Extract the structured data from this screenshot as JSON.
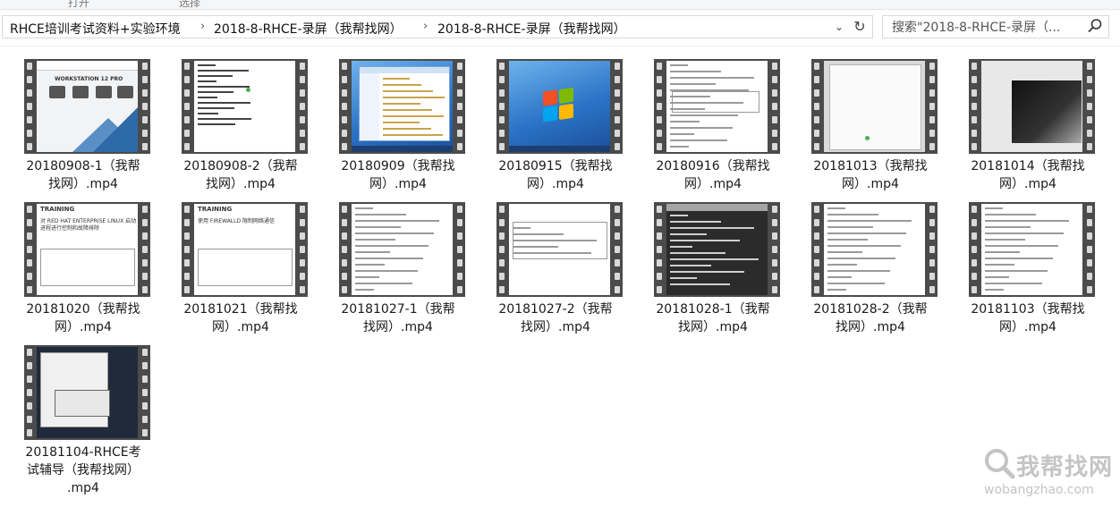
{
  "ribbon": {
    "left_text": "打开",
    "right_text": "选择"
  },
  "breadcrumb": [
    "RHCE培训考试资料+实验环境",
    "2018-8-RHCE-录屏（我帮找网）",
    "2018-8-RHCE-录屏（我帮找网）"
  ],
  "search": {
    "placeholder": "搜索\"2018-8-RHCE-录屏（..."
  },
  "files": [
    {
      "line1": "20180908-1（我帮",
      "line2": "找网）.mp4",
      "line3": "",
      "thumb": "vmware"
    },
    {
      "line1": "20180908-2（我帮",
      "line2": "找网）.mp4",
      "line3": "",
      "thumb": "terminal"
    },
    {
      "line1": "20180909（我帮找",
      "line2": "网）.mp4",
      "line3": "",
      "thumb": "win7-explorer"
    },
    {
      "line1": "20180915（我帮找",
      "line2": "网）.mp4",
      "line3": "",
      "thumb": "win7-desktop"
    },
    {
      "line1": "20180916（我帮找",
      "line2": "网）.mp4",
      "line3": "",
      "thumb": "document"
    },
    {
      "line1": "20181013（我帮找",
      "line2": "网）.mp4",
      "line3": "",
      "thumb": "gray-window"
    },
    {
      "line1": "20181014（我帮找",
      "line2": "网）.mp4",
      "line3": "",
      "thumb": "dark-window"
    },
    {
      "line1": "20181020（我帮找",
      "line2": "网）.mp4",
      "line3": "",
      "thumb": "training-1"
    },
    {
      "line1": "20181021（我帮找",
      "line2": "网）.mp4",
      "line3": "",
      "thumb": "training-2"
    },
    {
      "line1": "20181027-1（我帮",
      "line2": "找网）.mp4",
      "line3": "",
      "thumb": "document-list"
    },
    {
      "line1": "20181027-2（我帮",
      "line2": "找网）.mp4",
      "line3": "",
      "thumb": "table-doc"
    },
    {
      "line1": "20181028-1（我帮",
      "line2": "找网）.mp4",
      "line3": "",
      "thumb": "terminal-dark"
    },
    {
      "line1": "20181028-2（我帮",
      "line2": "找网）.mp4",
      "line3": "",
      "thumb": "document-text"
    },
    {
      "line1": "20181103（我帮找",
      "line2": "网）.mp4",
      "line3": "",
      "thumb": "document-text"
    },
    {
      "line1": "20181104-RHCE考",
      "line2": "试辅导（我帮找网）",
      "line3": ".mp4",
      "thumb": "app-window"
    }
  ],
  "thumb_labels": {
    "vmware": "WORKSTATION 12 PRO",
    "training1_title": "TRAINING",
    "training1_sub": "对 RED HAT ENTERPRISE LINUX 启动进程进行控制和故障排除",
    "training2_title": "TRAINING",
    "training2_sub": "使用 FIREWALLD 限制网络通信"
  },
  "watermark": {
    "text": "我帮找网",
    "url": "wobangzhao.com"
  },
  "colors": {
    "film": "#4b4b4b",
    "hole": "#d9d9d9",
    "win7_blue": "#2b74c7"
  }
}
